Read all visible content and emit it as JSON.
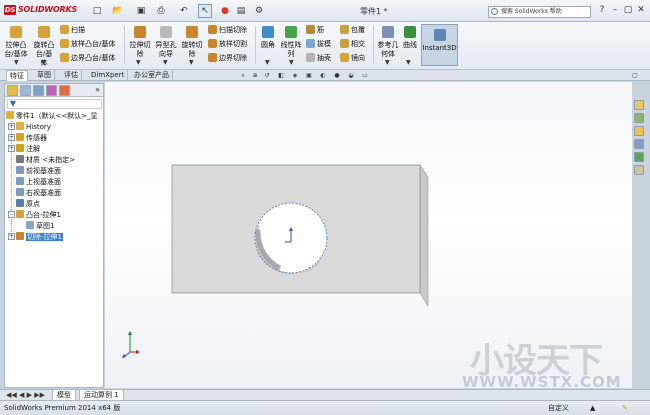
{
  "app": {
    "brand": "SOLIDWORKS",
    "document_title": "零件1 *",
    "help_search": "搜索 SolidWorks 帮助"
  },
  "window_buttons": [
    "?",
    "–",
    "▢",
    "✕"
  ],
  "ribbon": {
    "large": [
      {
        "label1": "拉伸凸",
        "label2": "台/基体",
        "icon": "extrude-boss-icon",
        "color": "#d8a23a"
      },
      {
        "label1": "旋转凸",
        "label2": "台/基",
        "label3": "体",
        "icon": "revolve-boss-icon",
        "color": "#d8a23a"
      },
      {
        "label1": "拉伸切",
        "label2": "除",
        "icon": "extrude-cut-icon",
        "color": "#c9862e"
      },
      {
        "label1": "异型孔",
        "label2": "向导",
        "icon": "hole-wizard-icon",
        "color": "#b9b9b9"
      },
      {
        "label1": "旋转切",
        "label2": "除",
        "icon": "revolve-cut-icon",
        "color": "#c9862e"
      },
      {
        "label1": "圆角",
        "label2": "",
        "icon": "fillet-icon",
        "color": "#3f8bc5"
      },
      {
        "label1": "线性阵",
        "label2": "列",
        "icon": "linear-pattern-icon",
        "color": "#4aa34a"
      },
      {
        "label1": "参考几",
        "label2": "何体",
        "icon": "reference-geometry-icon",
        "color": "#7d8fb3"
      },
      {
        "label1": "曲线",
        "label2": "",
        "icon": "curves-icon",
        "color": "#3a8f3a"
      },
      {
        "label1": "Instant3D",
        "label2": "",
        "icon": "instant3d-icon",
        "color": "#5d87b7"
      }
    ],
    "small": [
      {
        "label": "扫描",
        "icon": "sweep-icon",
        "color": "#d8a23a"
      },
      {
        "label": "放样凸台/基体",
        "icon": "loft-icon",
        "color": "#d8a23a"
      },
      {
        "label": "边界凸台/基体",
        "icon": "boundary-boss-icon",
        "color": "#d8a23a"
      },
      {
        "label": "扫描切除",
        "icon": "swept-cut-icon",
        "color": "#c9862e"
      },
      {
        "label": "放样切割",
        "icon": "lofted-cut-icon",
        "color": "#c9862e"
      },
      {
        "label": "边界切除",
        "icon": "boundary-cut-icon",
        "color": "#c9862e"
      },
      {
        "label": "筋",
        "icon": "rib-icon",
        "color": "#b48a3a"
      },
      {
        "label": "拔模",
        "icon": "draft-icon",
        "color": "#7aa7d1"
      },
      {
        "label": "抽壳",
        "icon": "shell-icon",
        "color": "#b4b4b4"
      },
      {
        "label": "包覆",
        "icon": "wrap-icon",
        "color": "#c9a040"
      },
      {
        "label": "相交",
        "icon": "intersect-icon",
        "color": "#c9a040"
      },
      {
        "label": "镜向",
        "icon": "mirror-icon",
        "color": "#d8a23a"
      }
    ]
  },
  "tabs": [
    "特征",
    "草图",
    "评估",
    "DimXpert",
    "办公室产品"
  ],
  "tree": {
    "root": "零件1（默认<<默认>_显",
    "items": [
      {
        "label": "History",
        "icon": "history-icon",
        "color": "#e0b040"
      },
      {
        "label": "传感器",
        "icon": "sensor-icon",
        "color": "#d9a22f"
      },
      {
        "label": "注解",
        "icon": "annotation-icon",
        "color": "#d0a020"
      },
      {
        "label": "材质 <未指定>",
        "icon": "material-icon",
        "color": "#7a7a7a"
      },
      {
        "label": "前视基准面",
        "icon": "plane-icon",
        "color": "#7e9bbd"
      },
      {
        "label": "上视基准面",
        "icon": "plane-icon",
        "color": "#7e9bbd"
      },
      {
        "label": "右视基准面",
        "icon": "plane-icon",
        "color": "#7e9bbd"
      },
      {
        "label": "原点",
        "icon": "origin-icon",
        "color": "#5a7fae"
      },
      {
        "label": "凸台-拉伸1",
        "icon": "boss-extrude-icon",
        "color": "#d8a23a"
      },
      {
        "label": "草图1",
        "icon": "sketch-icon",
        "color": "#8aa4c4"
      },
      {
        "label": "切除-拉伸1",
        "icon": "cut-extrude-icon",
        "color": "#c9862e"
      }
    ]
  },
  "bottom_tabs": [
    "模型",
    "运动算例 1"
  ],
  "status": {
    "left": "SolidWorks Premium 2014 x64 版",
    "right": "自定义"
  },
  "watermark": {
    "main": "小设天下",
    "sub": "WWW.WSTX.COM"
  },
  "colors": {
    "accent": "#3b7fd1",
    "part_face": "#d9d9d9",
    "selection_edge": "#4f79c2"
  }
}
